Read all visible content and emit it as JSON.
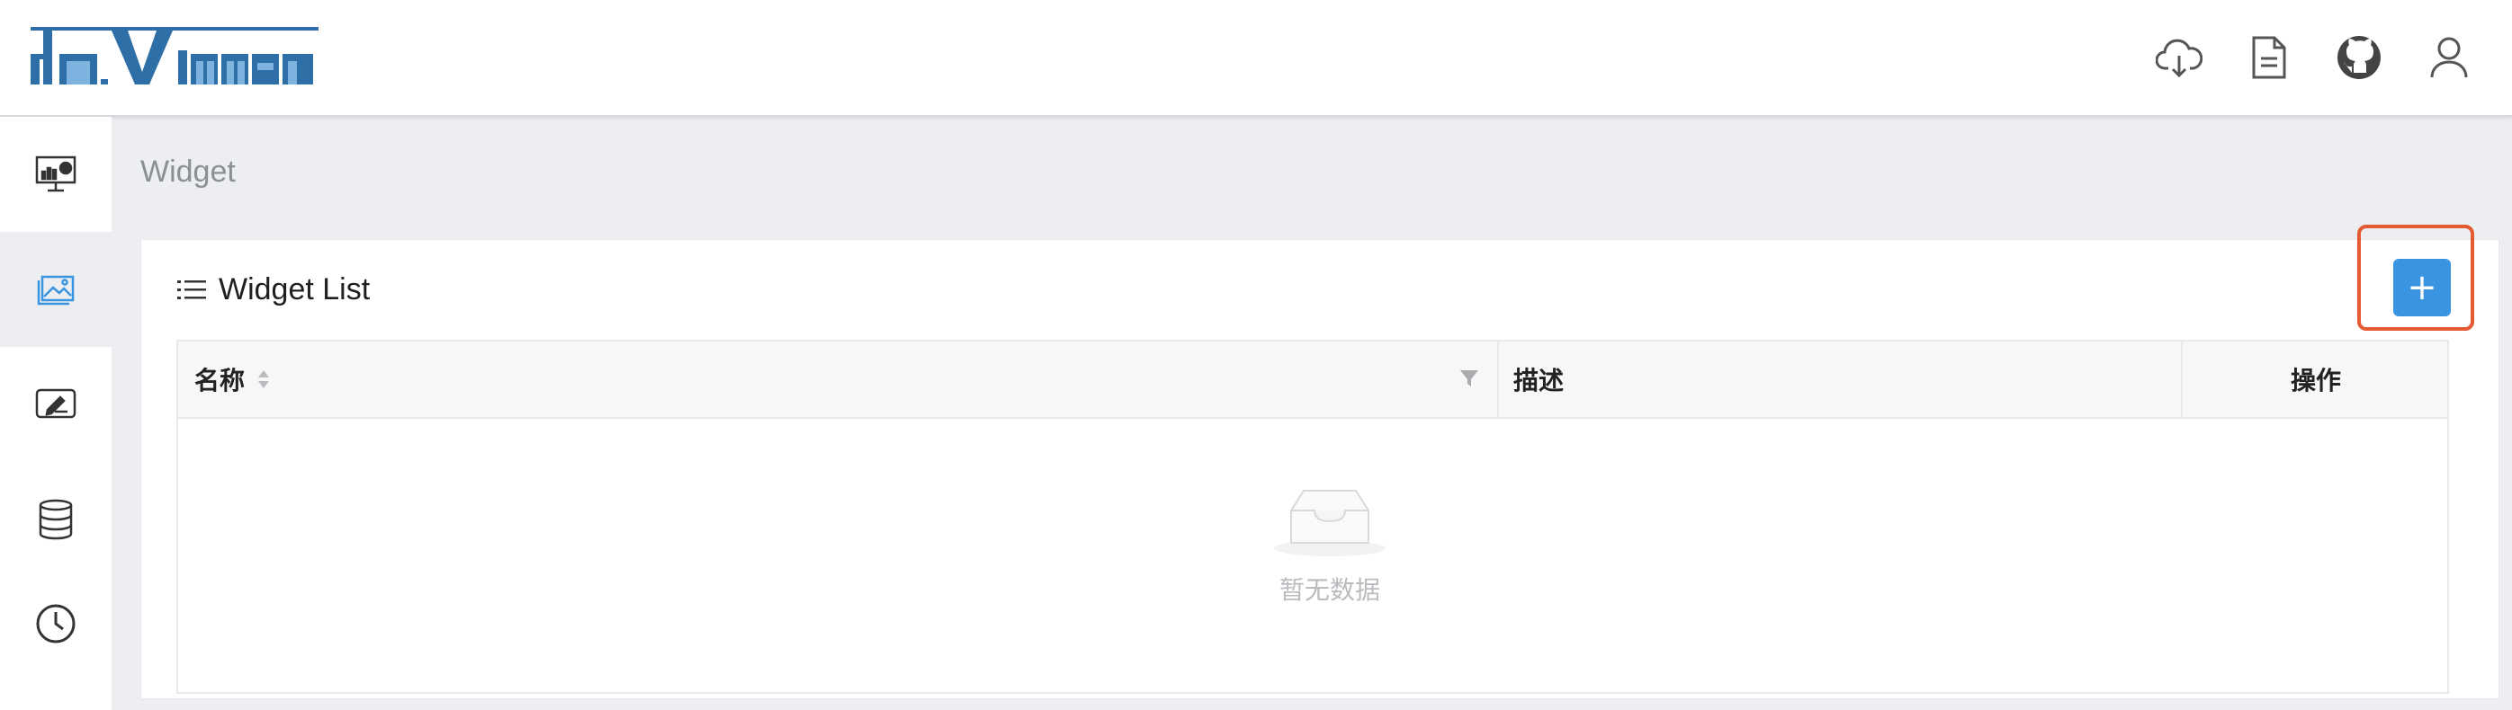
{
  "header": {
    "logo_text": "davinci",
    "icons": [
      "cloud-download-icon",
      "document-icon",
      "github-icon",
      "user-icon"
    ]
  },
  "sidebar": {
    "items": [
      {
        "name": "dashboard",
        "icon": "monitor-chart-icon",
        "active": false
      },
      {
        "name": "widget",
        "icon": "widget-picture-icon",
        "active": true
      },
      {
        "name": "editor",
        "icon": "edit-screen-icon",
        "active": false
      },
      {
        "name": "source",
        "icon": "database-icon",
        "active": false
      },
      {
        "name": "schedule",
        "icon": "clock-icon",
        "active": false
      }
    ]
  },
  "page": {
    "title": "Widget"
  },
  "card": {
    "title": "Widget List",
    "add_button": "+"
  },
  "table": {
    "columns": [
      "名称",
      "描述",
      "操作"
    ],
    "rows": [],
    "empty_text": "暂无数据"
  },
  "colors": {
    "accent": "#3b94e0",
    "logo": "#2f6fa8",
    "highlight": "#e45a33",
    "background": "#eceef2"
  }
}
